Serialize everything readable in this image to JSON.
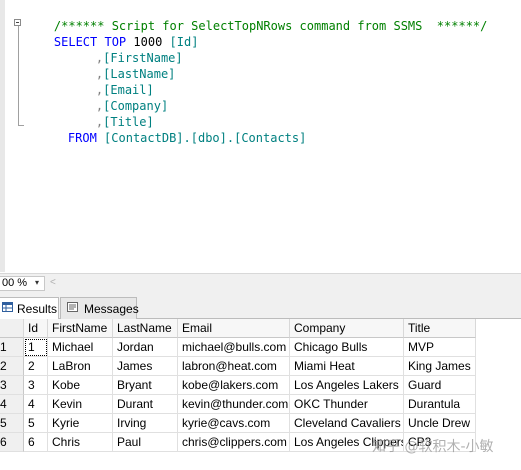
{
  "editor": {
    "comment": "/****** Script for SelectTopNRows command from SSMS  ******/",
    "kw_select_top": "SELECT TOP",
    "top_count": "1000",
    "columns": [
      "[Id]",
      "[FirstName]",
      "[LastName]",
      "[Email]",
      "[Company]",
      "[Title]"
    ],
    "comma": ",",
    "kw_from": "FROM",
    "table_ref": "[ContactDB].[dbo].[Contacts]"
  },
  "zoom": {
    "value": "00 %",
    "arrow": "▾",
    "scroll_left": "<"
  },
  "tabs": [
    {
      "label": "Results"
    },
    {
      "label": "Messages"
    }
  ],
  "grid": {
    "headers": [
      "Id",
      "FirstName",
      "LastName",
      "Email",
      "Company",
      "Title"
    ],
    "rows": [
      {
        "num": "1",
        "cells": [
          "1",
          "Michael",
          "Jordan",
          "michael@bulls.com",
          "Chicago Bulls",
          "MVP"
        ]
      },
      {
        "num": "2",
        "cells": [
          "2",
          "LaBron",
          "James",
          "labron@heat.com",
          "Miami Heat",
          "King James"
        ]
      },
      {
        "num": "3",
        "cells": [
          "3",
          "Kobe",
          "Bryant",
          "kobe@lakers.com",
          "Los Angeles Lakers",
          "Guard"
        ]
      },
      {
        "num": "4",
        "cells": [
          "4",
          "Kevin",
          "Durant",
          "kevin@thunder.com",
          "OKC Thunder",
          "Durantula"
        ]
      },
      {
        "num": "5",
        "cells": [
          "5",
          "Kyrie",
          "Irving",
          "kyrie@cavs.com",
          "Cleveland Cavaliers",
          "Uncle Drew"
        ]
      },
      {
        "num": "6",
        "cells": [
          "6",
          "Chris",
          "Paul",
          "chris@clippers.com",
          "Los Angeles Clippers",
          "CP3"
        ]
      }
    ]
  },
  "watermark": "知乎 @软积木-小敏",
  "colors": {
    "sql_keyword": "#0000ff",
    "sql_comment": "#008000",
    "sql_identifier": "#008080",
    "sql_punctuation": "#808080"
  }
}
